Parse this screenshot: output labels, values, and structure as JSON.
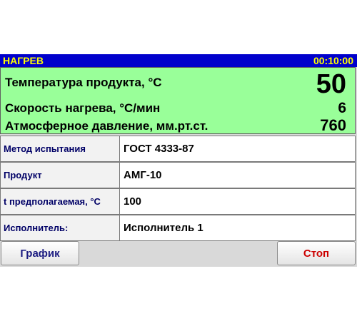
{
  "header": {
    "title": "НАГРЕВ",
    "clock": "00:10:00"
  },
  "readings": [
    {
      "label": "Температура продукта, °C",
      "value": "50"
    },
    {
      "label": "Скорость нагрева, °C/мин",
      "value": "6"
    },
    {
      "label": "Атмосферное давление, мм.рт.ст.",
      "value": "760"
    }
  ],
  "params": [
    {
      "label": "Метод испытания",
      "value": "ГОСТ 4333-87"
    },
    {
      "label": "Продукт",
      "value": "АМГ-10"
    },
    {
      "label": "t предполагаемая, °C",
      "value": "100"
    },
    {
      "label": "Исполнитель:",
      "value": "Исполнитель 1"
    }
  ],
  "buttons": {
    "chart_label": "График",
    "stop_label": "Стоп"
  },
  "colors": {
    "titlebar_bg": "#0000cc",
    "titlebar_text": "#ffff00",
    "readings_bg": "#99ff99",
    "stop_text": "#cc0000"
  }
}
